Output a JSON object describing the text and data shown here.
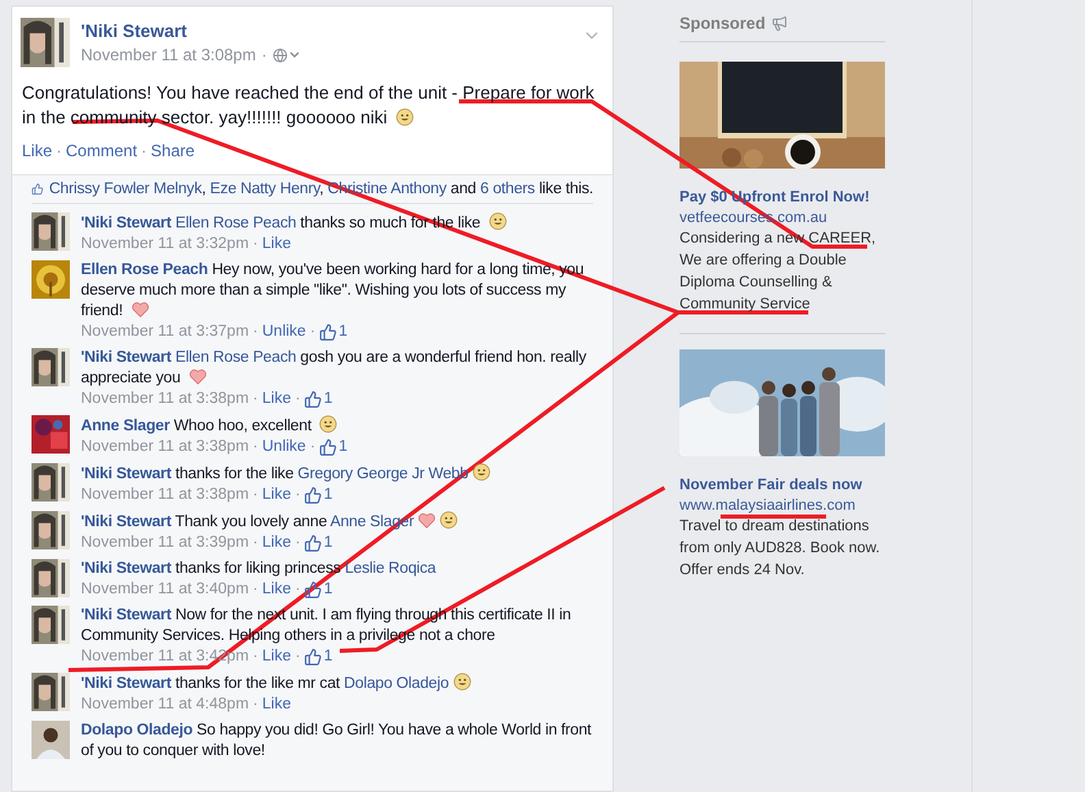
{
  "separator": "·",
  "post": {
    "author": "'Niki Stewart",
    "time": "November 11 at 3:08pm",
    "text": [
      {
        "kind": "text",
        "text": "Congratulations! You have reached the end of the unit - Prepare for work in the community sector. yay!!!!!!! goooooo niki "
      },
      {
        "kind": "smile"
      }
    ],
    "actions": [
      "Like",
      "Comment",
      "Share"
    ],
    "likes": [
      {
        "kind": "mention",
        "text": "Chrissy Fowler Melnyk"
      },
      {
        "kind": "text",
        "text": ", "
      },
      {
        "kind": "mention",
        "text": "Eze Natty Henry"
      },
      {
        "kind": "text",
        "text": ", "
      },
      {
        "kind": "mention",
        "text": "Christine Anthony"
      },
      {
        "kind": "text",
        "text": " and "
      },
      {
        "kind": "mention",
        "text": "6 others"
      },
      {
        "kind": "text",
        "text": " like this."
      }
    ]
  },
  "comments": [
    {
      "author": "'Niki Stewart",
      "parts": [
        {
          "kind": "mention",
          "text": "Ellen Rose Peach"
        },
        {
          "kind": "text",
          "text": " thanks so much for the like "
        },
        {
          "kind": "smile"
        }
      ],
      "time": "November 11 at 3:32pm",
      "action": "Like"
    },
    {
      "author": "Ellen Rose Peach",
      "parts": [
        {
          "kind": "text",
          "text": "Hey now, you've been working hard for a long time, you deserve much more than a simple \"like\". Wishing you lots of success my friend! "
        },
        {
          "kind": "heart"
        }
      ],
      "time": "November 11 at 3:37pm",
      "action": "Unlike",
      "like_count": "1"
    },
    {
      "author": "'Niki Stewart",
      "parts": [
        {
          "kind": "mention",
          "text": "Ellen Rose Peach"
        },
        {
          "kind": "text",
          "text": " gosh you are a wonderful friend hon. really appreciate you "
        },
        {
          "kind": "heart"
        }
      ],
      "time": "November 11 at 3:38pm",
      "action": "Like",
      "like_count": "1"
    },
    {
      "author": "Anne Slager",
      "parts": [
        {
          "kind": "text",
          "text": "Whoo hoo, excellent "
        },
        {
          "kind": "smile"
        }
      ],
      "time": "November 11 at 3:38pm",
      "action": "Unlike",
      "like_count": "1"
    },
    {
      "author": "'Niki Stewart",
      "parts": [
        {
          "kind": "text",
          "text": "thanks for the like "
        },
        {
          "kind": "mention",
          "text": "Gregory George Jr Webb"
        },
        {
          "kind": "smile"
        }
      ],
      "time": "November 11 at 3:38pm",
      "action": "Like",
      "like_count": "1"
    },
    {
      "author": "'Niki Stewart",
      "parts": [
        {
          "kind": "text",
          "text": "Thank you lovely anne "
        },
        {
          "kind": "mention",
          "text": "Anne Slager"
        },
        {
          "kind": "heart"
        },
        {
          "kind": "smile"
        }
      ],
      "time": "November 11 at 3:39pm",
      "action": "Like",
      "like_count": "1"
    },
    {
      "author": "'Niki Stewart",
      "parts": [
        {
          "kind": "text",
          "text": "thanks for liking princess "
        },
        {
          "kind": "mention",
          "text": "Leslie Roqica"
        }
      ],
      "time": "November 11 at 3:40pm",
      "action": "Like",
      "like_count": "1"
    },
    {
      "author": "'Niki Stewart",
      "parts": [
        {
          "kind": "text",
          "text": "Now for the next unit. I am flying through this certificate II in Community Services. Helping others in a privilege not a chore"
        }
      ],
      "time": "November 11 at 3:42pm",
      "action": "Like",
      "like_count": "1"
    },
    {
      "author": "'Niki Stewart",
      "parts": [
        {
          "kind": "text",
          "text": "thanks for the like mr cat "
        },
        {
          "kind": "mention",
          "text": "Dolapo Oladejo"
        },
        {
          "kind": "smile"
        }
      ],
      "time": "November 11 at 4:48pm",
      "action": "Like"
    },
    {
      "author": "Dolapo Oladejo",
      "parts": [
        {
          "kind": "text",
          "text": "So happy you did! Go Girl! You have a whole World in front of you to conquer with love!"
        }
      ]
    }
  ],
  "sponsored": {
    "title": "Sponsored",
    "ads": [
      {
        "title": "Pay $0 Upfront Enrol Now!",
        "url": "vetfeecourses.com.au",
        "body": "Considering a new CAREER, We are offering a Double Diploma Counselling & Community Service"
      },
      {
        "title": "November Fair deals now",
        "url": "www.malaysiaairlines.com",
        "body": "Travel to dream destinations from only AUD828. Book now. Offer ends 24 Nov."
      }
    ]
  }
}
